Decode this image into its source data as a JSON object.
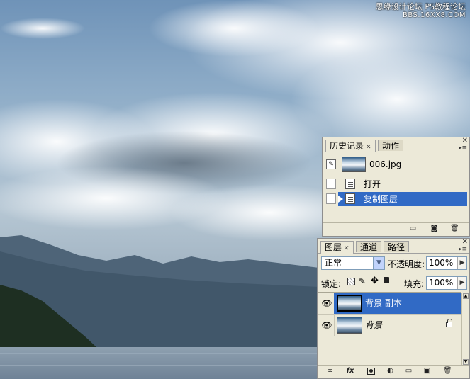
{
  "watermark": {
    "line1": "思缘设计论坛 PS教程论坛",
    "line2": "BBS.16XX8.COM"
  },
  "history_panel": {
    "tabs": [
      {
        "label": "历史记录",
        "active": true
      },
      {
        "label": "动作",
        "active": false
      }
    ],
    "snapshot": {
      "label": "006.jpg"
    },
    "items": [
      {
        "label": "打开",
        "selected": false
      },
      {
        "label": "复制图层",
        "selected": true
      }
    ],
    "menu_glyph": "▾≡",
    "close_glyph": "✕"
  },
  "layers_panel": {
    "tabs": [
      {
        "label": "图层",
        "active": true
      },
      {
        "label": "通道",
        "active": false
      },
      {
        "label": "路径",
        "active": false
      }
    ],
    "blend_mode": "正常",
    "opacity_label": "不透明度:",
    "opacity_value": "100%",
    "lock_label": "锁定:",
    "fill_label": "填充:",
    "fill_value": "100%",
    "layers": [
      {
        "name": "背景 副本",
        "selected": true,
        "visible": true,
        "locked": false
      },
      {
        "name": "背景",
        "selected": false,
        "visible": true,
        "locked": true
      }
    ],
    "bottom_icons": [
      "link-icon",
      "fx-icon",
      "mask-icon",
      "adjustment-icon",
      "folder-icon",
      "new-layer-icon",
      "trash-icon"
    ],
    "fx_label": "fx"
  },
  "colors": {
    "selection": "#316ac5",
    "panel_bg": "#ece9d8"
  }
}
